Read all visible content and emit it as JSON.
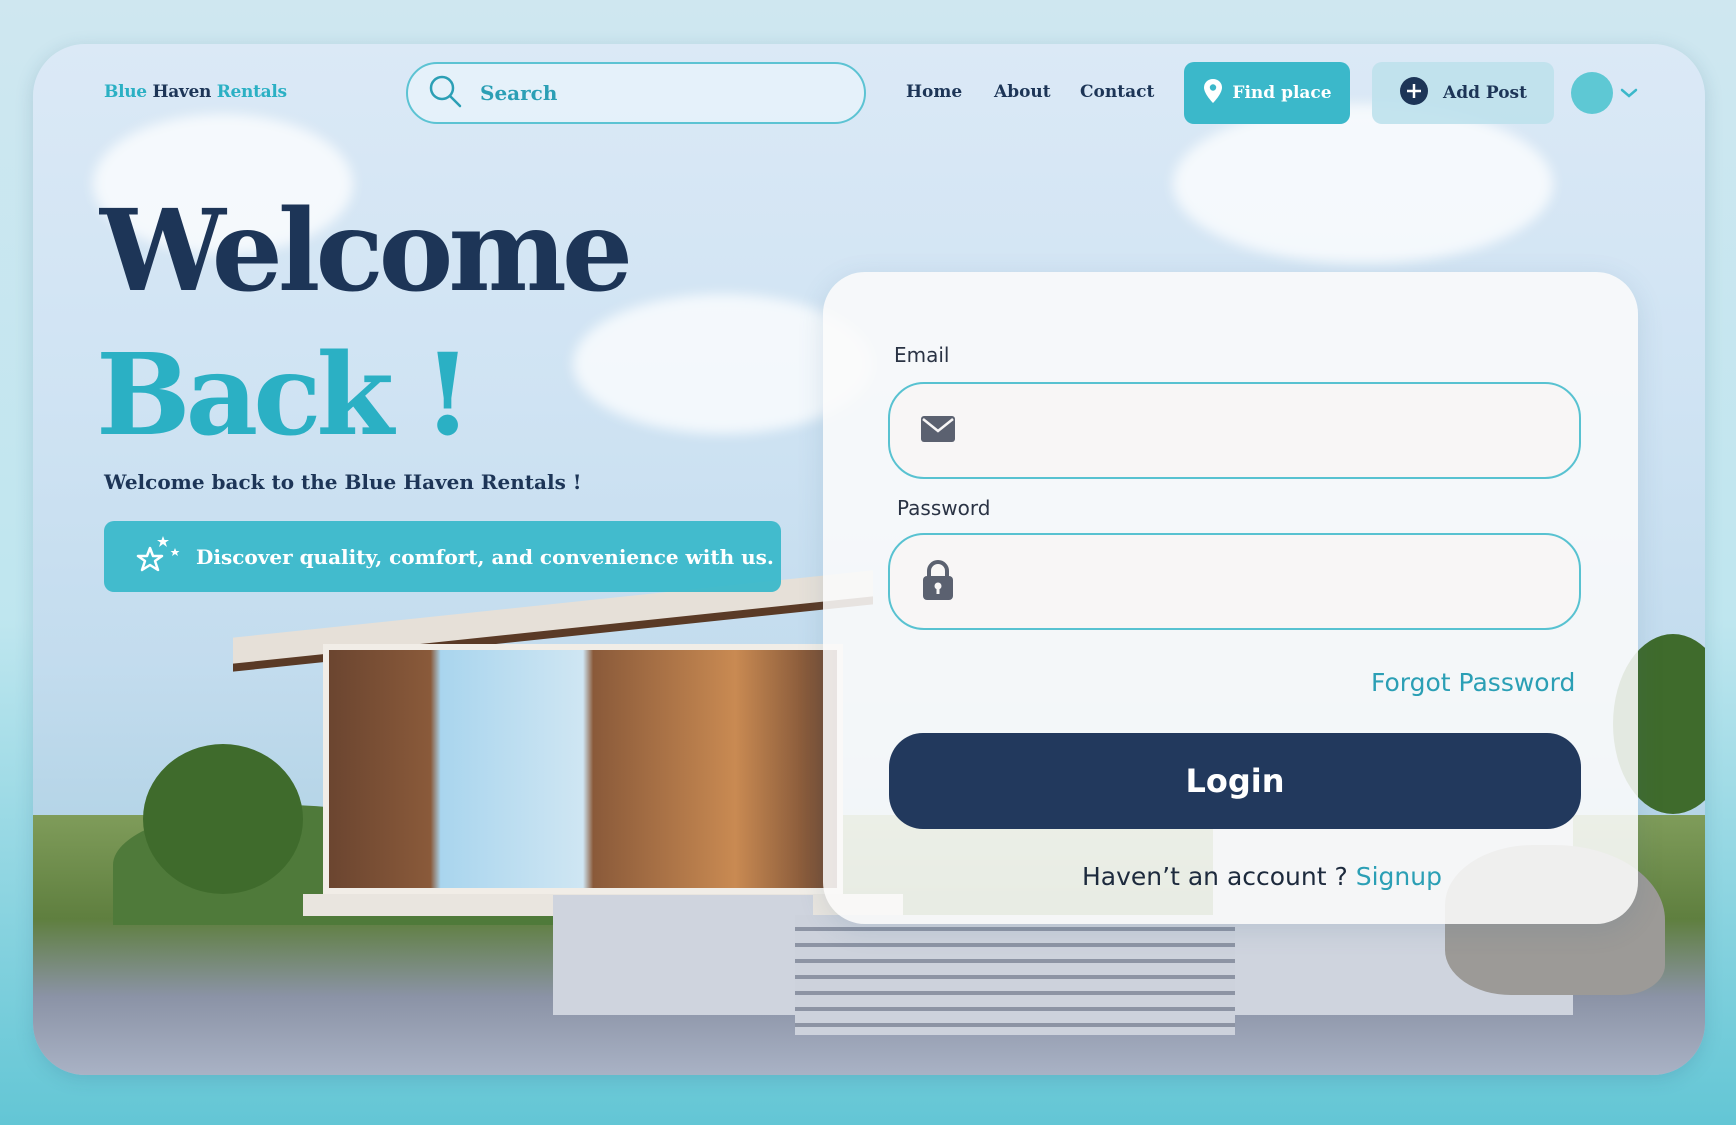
{
  "brand": {
    "part1": "Blue",
    "part2": "Haven",
    "part3": "Rentals"
  },
  "search": {
    "placeholder": "Search"
  },
  "nav": {
    "home": "Home",
    "about": "About",
    "contact": "Contact"
  },
  "actions": {
    "find_place": "Find place",
    "add_post": "Add Post"
  },
  "hero": {
    "title_line1": "Welcome",
    "title_line2": "Back !",
    "subtitle": "Welcome back to the Blue Haven Rentals !",
    "banner_text": "Discover quality, comfort, and convenience with us."
  },
  "login_form": {
    "email_label": "Email",
    "email_value": "",
    "password_label": "Password",
    "password_value": "",
    "forgot_password": "Forgot Password",
    "login_button": "Login",
    "no_account_text": "Haven’t an account ?",
    "signup_link": "Signup"
  },
  "colors": {
    "primary_navy": "#22395d",
    "accent_teal": "#3bb8ca",
    "link_teal": "#2b9fb5"
  },
  "icons": {
    "search": "search-icon",
    "find_place": "map-pin-icon",
    "add_post": "plus-circle-icon",
    "banner": "sparkle-stars-icon",
    "email": "envelope-icon",
    "password": "lock-icon",
    "profile_menu": "chevron-down-icon"
  }
}
